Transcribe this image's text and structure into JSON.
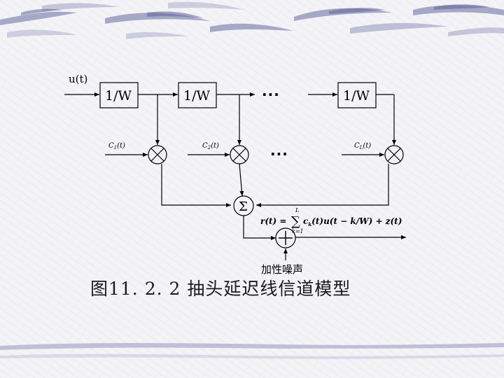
{
  "diagram": {
    "input_label": "u(t)",
    "delay_labels": [
      "1/W",
      "1/W",
      "1/W"
    ],
    "ellipsis_top": "···",
    "ellipsis_mid": "···",
    "coeff": [
      {
        "main": "C",
        "sub": "1",
        "arg": "(t)"
      },
      {
        "main": "C",
        "sub": "2",
        "arg": "(t)"
      },
      {
        "main": "C",
        "sub": "L",
        "arg": "(t)"
      }
    ],
    "multiply_symbol": "×",
    "sum_symbol": "Σ",
    "add_symbol": "+",
    "formula": {
      "lhs": "r(t) =",
      "sum": "∑",
      "upper": "L",
      "lower": "k=1",
      "rhs": "c",
      "rhs_sub": "k",
      "rhs_rest": "(t)u(t − k/W) + z(t)"
    },
    "noise_label": "加性噪声"
  },
  "caption": "图11. 2. 2  抽头延迟线信道模型",
  "colors": {
    "background": "#f4f4f7",
    "band": "#8d8fb8",
    "ink": "#000000"
  }
}
